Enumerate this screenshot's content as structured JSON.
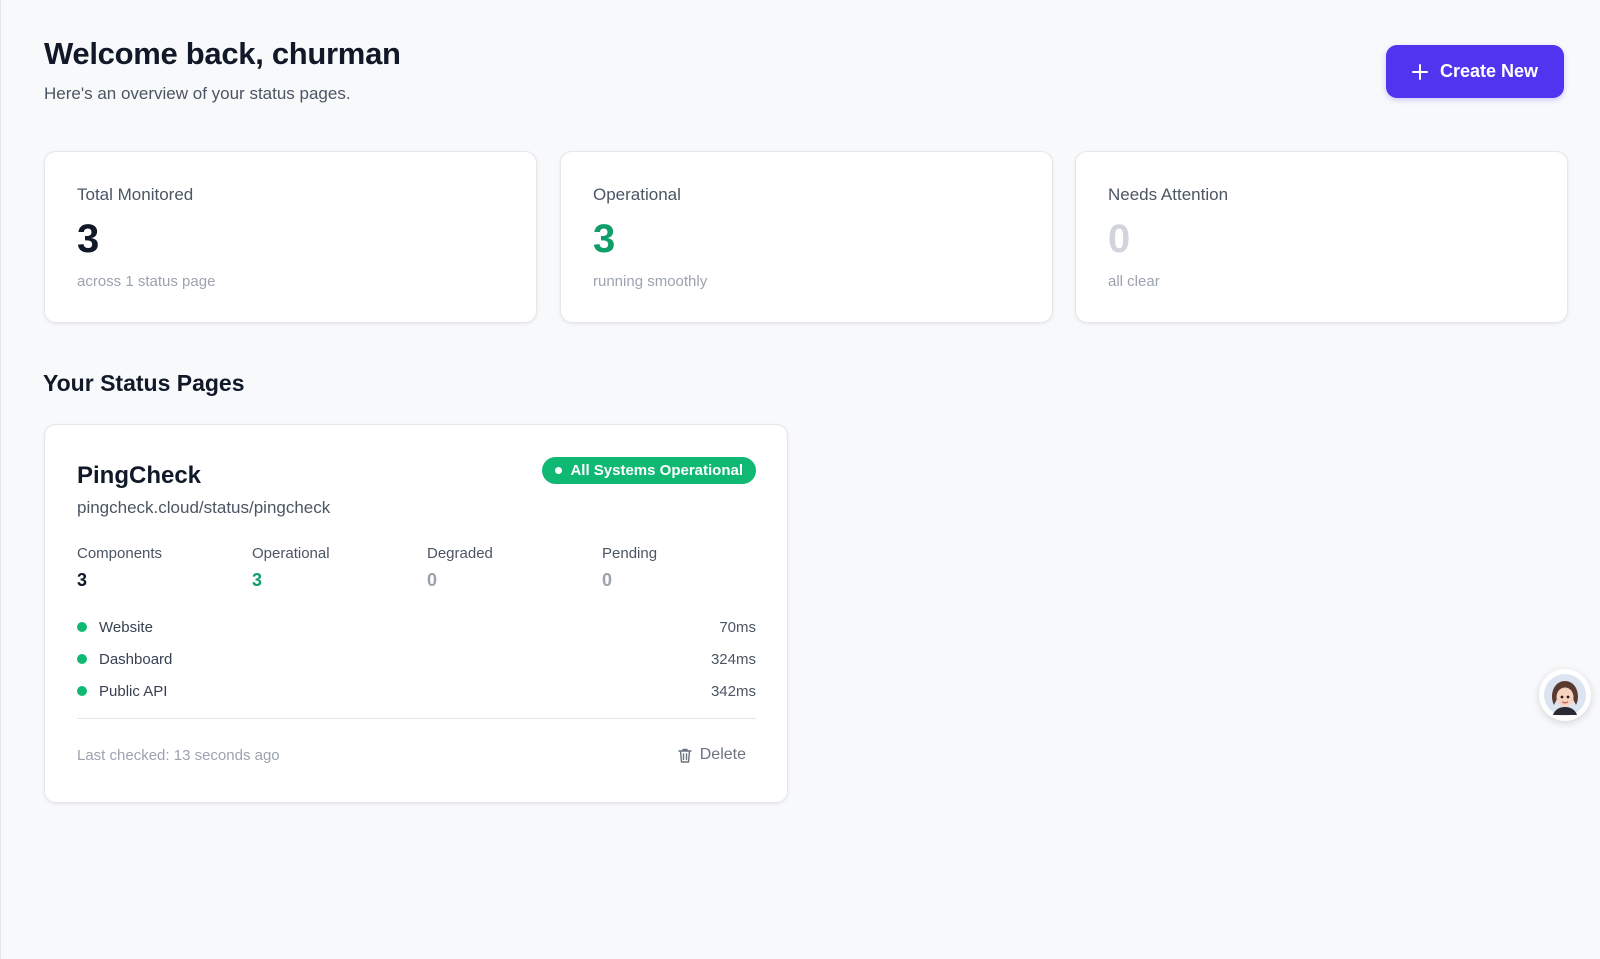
{
  "header": {
    "title": "Welcome back, churman",
    "subtitle": "Here's an overview of your status pages."
  },
  "create_button": {
    "label": "Create New",
    "icon": "plus-icon"
  },
  "stats": [
    {
      "label": "Total Monitored",
      "value": "3",
      "note": "across 1 status page",
      "value_color": "#111827"
    },
    {
      "label": "Operational",
      "value": "3",
      "note": "running smoothly",
      "value_color": "#0f9d68"
    },
    {
      "label": "Needs Attention",
      "value": "0",
      "note": "all clear",
      "value_color": "#d1d5db"
    }
  ],
  "section_title": "Your Status Pages",
  "status_page": {
    "name": "PingCheck",
    "url": "pingcheck.cloud/status/pingcheck",
    "badge": "All Systems Operational",
    "metrics": [
      {
        "label": "Components",
        "value": "3",
        "color": "#111827"
      },
      {
        "label": "Operational",
        "value": "3",
        "color": "#0f9d68"
      },
      {
        "label": "Degraded",
        "value": "0",
        "color": "#9ca3af"
      },
      {
        "label": "Pending",
        "value": "0",
        "color": "#9ca3af"
      }
    ],
    "components": [
      {
        "name": "Website",
        "latency": "70ms",
        "status_color": "#10b973"
      },
      {
        "name": "Dashboard",
        "latency": "324ms",
        "status_color": "#10b973"
      },
      {
        "name": "Public API",
        "latency": "342ms",
        "status_color": "#10b973"
      }
    ],
    "last_checked": "Last checked: 13 seconds ago",
    "delete_label": "Delete"
  },
  "colors": {
    "accent": "#4f35ef",
    "success": "#10b973"
  }
}
